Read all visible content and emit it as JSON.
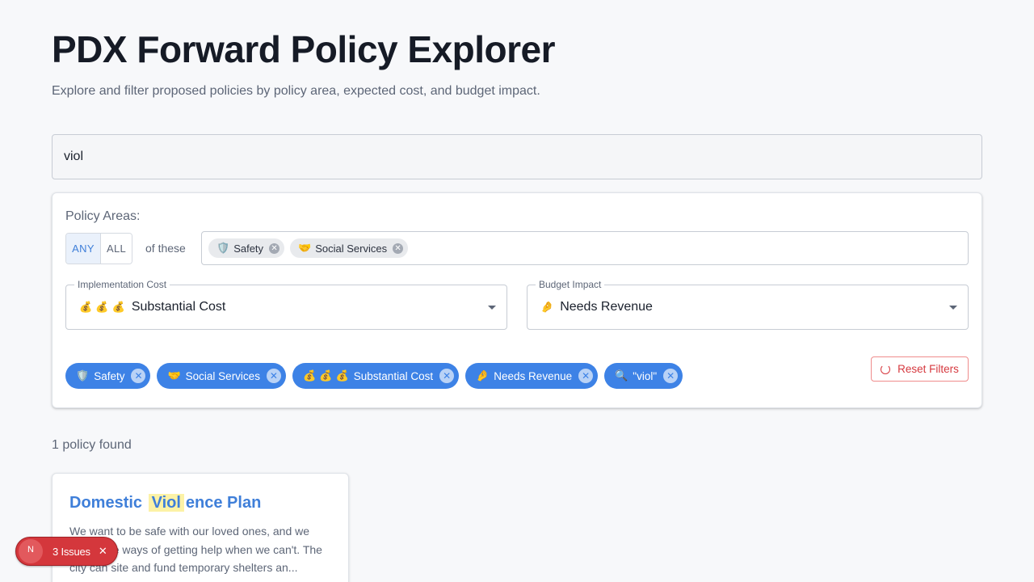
{
  "header": {
    "title": "PDX Forward Policy Explorer",
    "subtitle": "Explore and filter proposed policies by policy area, expected cost, and budget impact."
  },
  "search": {
    "value": "viol"
  },
  "filters": {
    "areas_label": "Policy Areas:",
    "match_any": "ANY",
    "match_all": "ALL",
    "of_these": "of these",
    "selected_areas": [
      {
        "icon": "🛡️",
        "label": "Safety"
      },
      {
        "icon": "🤝",
        "label": "Social Services"
      }
    ],
    "cost": {
      "label": "Implementation Cost",
      "icon": "💰 💰 💰",
      "value": "Substantial Cost"
    },
    "budget": {
      "label": "Budget Impact",
      "icon": "🤌",
      "value": "Needs Revenue"
    },
    "active_chips": [
      {
        "icon": "🛡️",
        "label": "Safety"
      },
      {
        "icon": "🤝",
        "label": "Social Services"
      },
      {
        "icon": "💰 💰 💰",
        "label": "Substantial Cost"
      },
      {
        "icon": "🤌",
        "label": "Needs Revenue"
      },
      {
        "icon": "🔍",
        "label": "\"viol\""
      }
    ],
    "reset_label": "Reset Filters"
  },
  "results": {
    "count_text": "1 policy found",
    "cards": [
      {
        "title_pre": "Domestic",
        "title_match": "Viol",
        "title_post": "ence Plan",
        "description": "We want to be safe with our loved ones, and we need safe ways of getting help when we can't. The city can site and fund temporary shelters an..."
      }
    ]
  },
  "issues": {
    "logo": "N",
    "label": "3 Issues",
    "close": "✕"
  },
  "colors": {
    "accent": "#3d82e6",
    "danger": "#d6393f",
    "highlight": "#fcf2a6"
  }
}
